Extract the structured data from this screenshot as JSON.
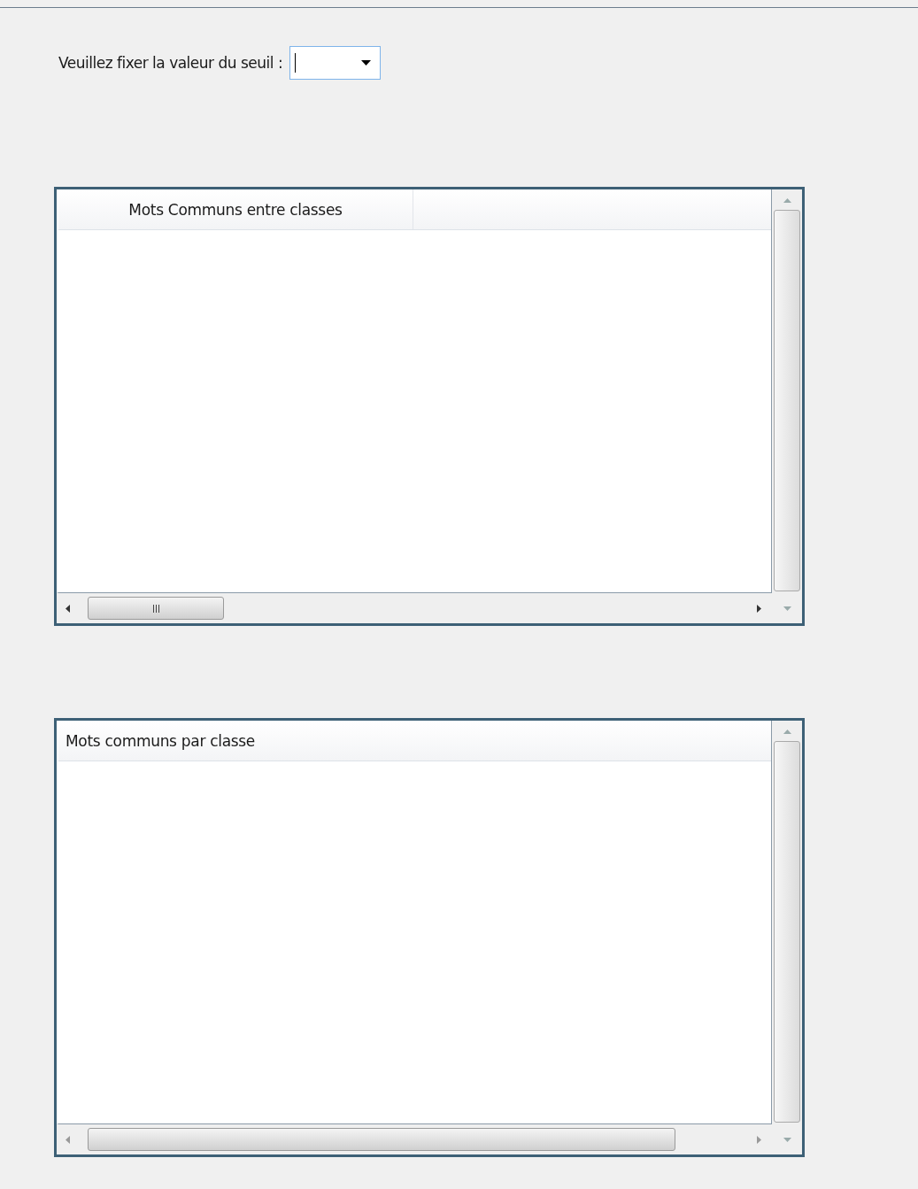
{
  "threshold": {
    "label": "Veuillez fixer la valeur du seuil :"
  },
  "tables": [
    {
      "kind": "grid",
      "header": "Mots Communs entre classes"
    },
    {
      "kind": "list",
      "header": "Mots communs par classe"
    }
  ]
}
